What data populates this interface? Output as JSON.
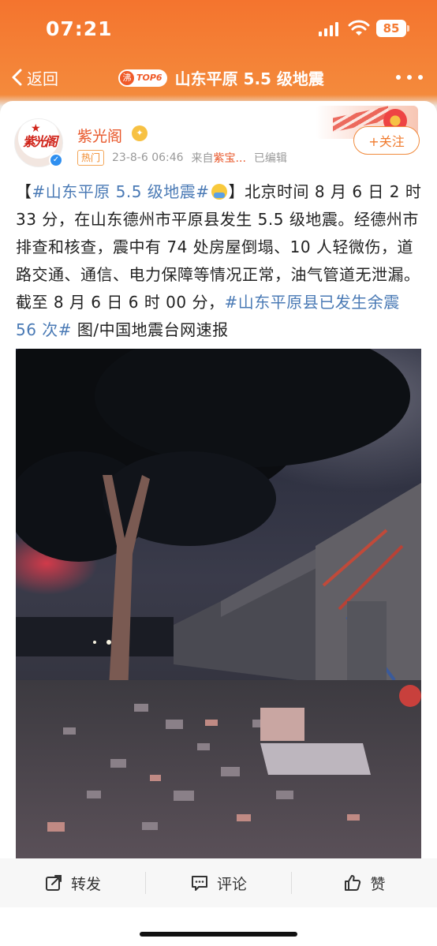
{
  "status_bar": {
    "time": "07:21",
    "battery": "85"
  },
  "nav": {
    "back_label": "返回",
    "hot_icon": "沸",
    "hot_rank": "TOP6",
    "title": "山东平原 5.5 级地震"
  },
  "author": {
    "name": "紫光阁",
    "avatar_text": "紫光阁",
    "hot_tag": "热门",
    "time": "23-8-6 06:46",
    "source_prefix": "来自",
    "source_name": "紫宝...",
    "edited": "已编辑",
    "follow_label": "+关注"
  },
  "post": {
    "bracket_open": "【",
    "topic1": "#山东平原 5.5 级地震#",
    "bracket_close": "】",
    "body": "北京时间 8 月 6 日 2 时 33 分，在山东德州市平原县发生 5.5 级地震。经德州市排查和核查，震中有 74 处房屋倒塌、10 人轻微伤，道路交通、通信、电力保障等情况正常，油气管道无泄漏。截至 8 月 6 日 6 时 00 分，",
    "topic2": "#山东平原县已发生余震 56 次#",
    "tail": " 图/中国地震台网速报"
  },
  "actions": {
    "repost_label": "转发",
    "comment_label": "评论",
    "like_label": "赞"
  },
  "colors": {
    "accent": "#f4742e",
    "topic": "#4a7ab5",
    "name": "#e8572a"
  }
}
